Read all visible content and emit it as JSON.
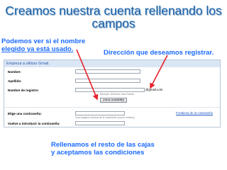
{
  "slide": {
    "title": "Creamos nuestra cuenta rellenando los campos",
    "note_left_line1": "Podemos ver si el nombre",
    "note_left_line2": "elegido  ya está usado.",
    "note_right": "Dirección que deseamos registrar.",
    "note_bottom_line1": "Rellenamos el resto de las cajas",
    "note_bottom_line2": "y aceptamos las condiciones"
  },
  "form": {
    "header": "Empieza a utilizar Gmail.",
    "first_name_label": "Nombre:",
    "last_name_label": "Apellido:",
    "username_label": "Nombre de registro:",
    "username_suffix": "@gmail.com",
    "username_hint": "Ejemplo: AGarcia, Ana.Garcia",
    "check_button": "¡check availability!",
    "password_label": "Elige una contraseña:",
    "password_strength_link": "Fortaleza de la contraseña",
    "password_hint": "Una longitud mínima de 8 caracteres (como mínimo)",
    "confirm_password_label": "Vuelve a introducir la contraseña:"
  },
  "colors": {
    "title": "#1a62a8",
    "notes": "#1a6aff",
    "arrow": "#e8222a"
  }
}
